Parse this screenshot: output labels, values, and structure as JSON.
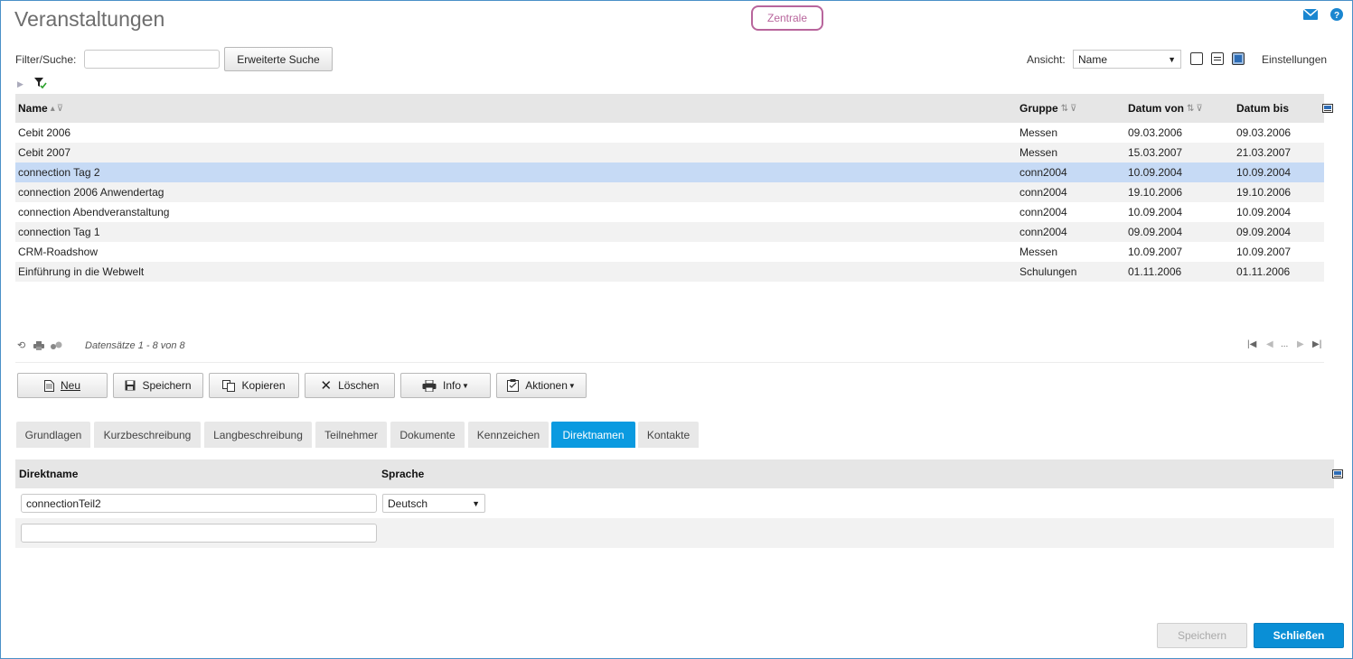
{
  "page": {
    "title": "Veranstaltungen",
    "context_badge": "Zentrale"
  },
  "toolbar": {
    "filter_label": "Filter/Suche:",
    "filter_value": "",
    "advanced_search_label": "Erweiterte Suche",
    "view_label": "Ansicht:",
    "view_value": "Name",
    "settings_label": "Einstellungen"
  },
  "grid": {
    "columns": [
      "Name",
      "Gruppe",
      "Datum von",
      "Datum bis"
    ],
    "rows": [
      {
        "name": "Cebit 2006",
        "gruppe": "Messen",
        "von": "09.03.2006",
        "bis": "09.03.2006"
      },
      {
        "name": "Cebit 2007",
        "gruppe": "Messen",
        "von": "15.03.2007",
        "bis": "21.03.2007"
      },
      {
        "name": "connection Tag 2",
        "gruppe": "conn2004",
        "von": "10.09.2004",
        "bis": "10.09.2004"
      },
      {
        "name": "connection 2006 Anwendertag",
        "gruppe": "conn2004",
        "von": "19.10.2006",
        "bis": "19.10.2006"
      },
      {
        "name": "connection Abendveranstaltung",
        "gruppe": "conn2004",
        "von": "10.09.2004",
        "bis": "10.09.2004"
      },
      {
        "name": "connection Tag 1",
        "gruppe": "conn2004",
        "von": "09.09.2004",
        "bis": "09.09.2004"
      },
      {
        "name": "CRM-Roadshow",
        "gruppe": "Messen",
        "von": "10.09.2007",
        "bis": "10.09.2007"
      },
      {
        "name": "Einführung in die Webwelt",
        "gruppe": "Schulungen",
        "von": "01.11.2006",
        "bis": "01.11.2006"
      }
    ],
    "selected_row": "connection Tag 2",
    "record_info": "Datensätze 1 - 8 von 8",
    "pager_ellipsis": "..."
  },
  "actions": {
    "new": "Neu",
    "save": "Speichern",
    "copy": "Kopieren",
    "delete": "Löschen",
    "info": "Info",
    "actions": "Aktionen"
  },
  "tabs": [
    "Grundlagen",
    "Kurzbeschreibung",
    "Langbeschreibung",
    "Teilnehmer",
    "Dokumente",
    "Kennzeichen",
    "Direktnamen",
    "Kontakte"
  ],
  "active_tab": "Direktnamen",
  "direktnamen": {
    "col_name": "Direktname",
    "col_lang": "Sprache",
    "row1_value": "connectionTeil2",
    "row1_lang": "Deutsch",
    "row2_value": ""
  },
  "footer": {
    "save": "Speichern",
    "close": "Schließen"
  },
  "colors": {
    "accent": "#0a9ae0",
    "badge": "#b8659c",
    "selected_row": "#c6daf5"
  }
}
